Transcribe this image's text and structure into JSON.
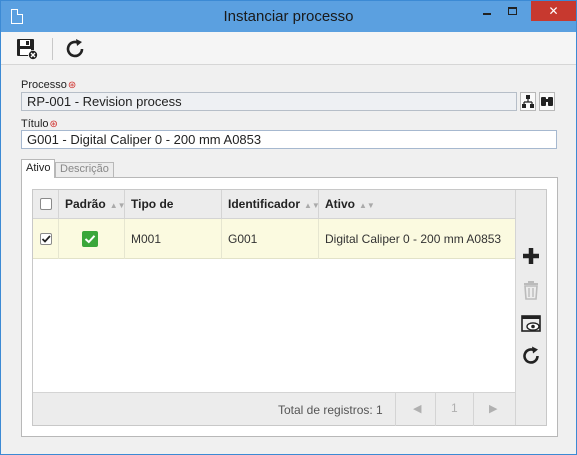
{
  "window": {
    "title": "Instanciar processo"
  },
  "form": {
    "process_label": "Processo",
    "process_value": "RP-001 - Revision process",
    "title_label": "Título",
    "title_value": "G001 - Digital Caliper 0 - 200 mm A0853"
  },
  "tabs": [
    {
      "label": "Ativo",
      "active": true
    },
    {
      "label": "Descrição",
      "active": false
    }
  ],
  "grid": {
    "columns": [
      "Padrão",
      "Tipo de ativo",
      "Identificador",
      "Ativo"
    ],
    "rows": [
      {
        "checked": true,
        "default": true,
        "type": "M001",
        "identifier": "G001",
        "asset": "Digital Caliper 0 - 200 mm A0853"
      }
    ],
    "total_label": "Total de registros: 1",
    "page": "1"
  },
  "colors": {
    "titlebar": "#5ba0e0",
    "close": "#c7392f",
    "required": "#d0302c",
    "selected_row": "#fbfae0",
    "check_green": "#3aa63a"
  }
}
